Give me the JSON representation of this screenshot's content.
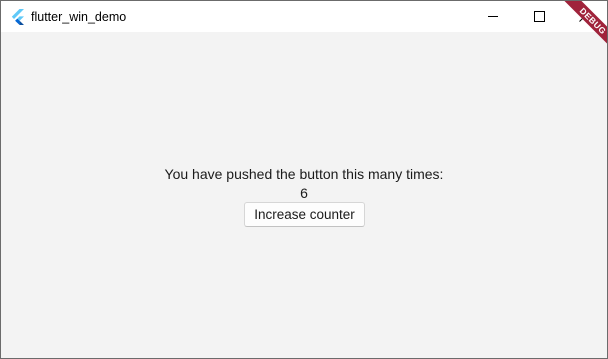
{
  "window": {
    "title": "flutter_win_demo",
    "icon": "flutter-logo-icon",
    "controls": {
      "minimize_icon": "minimize-icon",
      "maximize_icon": "maximize-icon",
      "close_icon": "close-icon"
    }
  },
  "main": {
    "message": "You have pushed the button this many times:",
    "counter": "6",
    "increase_button_label": "Increase counter"
  },
  "debug_banner": {
    "label": "DEBUG",
    "color": "#a0233b"
  },
  "colors": {
    "background": "#f3f3f3",
    "titlebar": "#ffffff",
    "flutter_light": "#5fc9f8",
    "flutter_dark": "#0468d7"
  }
}
